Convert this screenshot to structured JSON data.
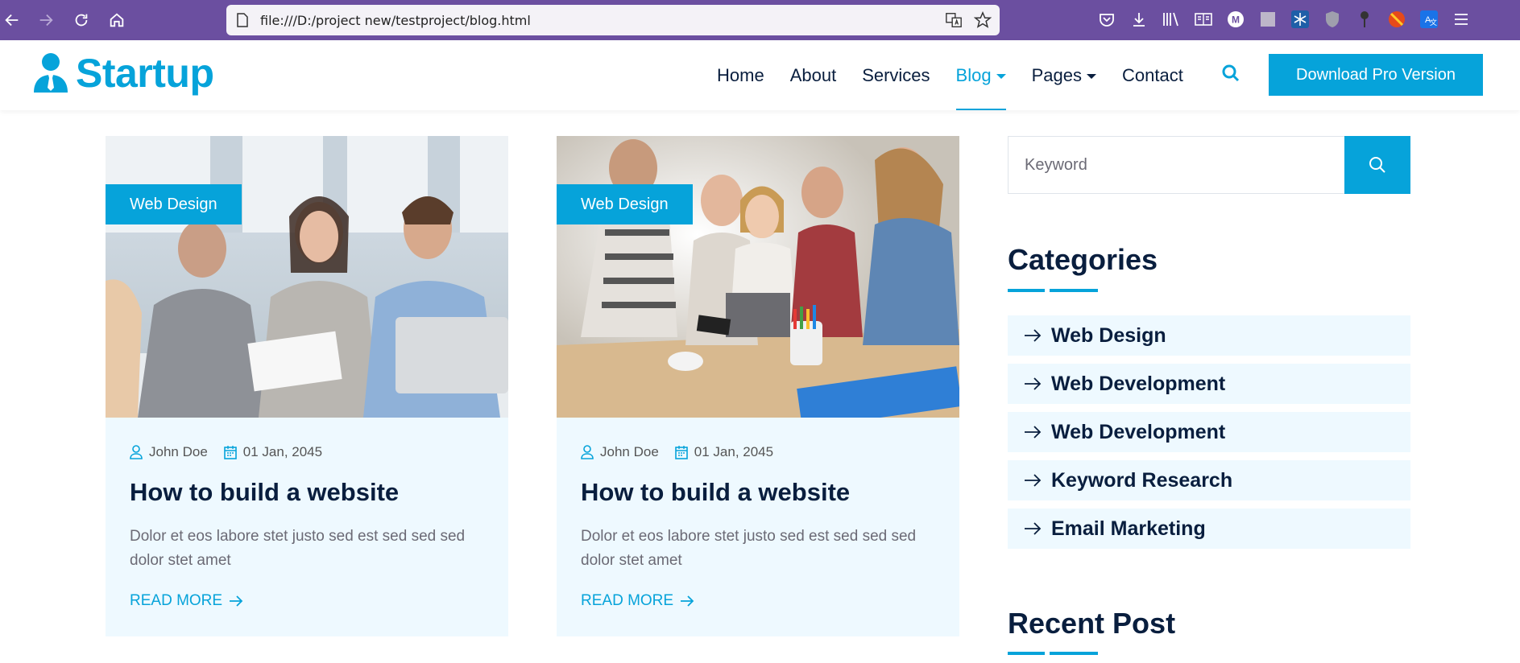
{
  "browser": {
    "url": "file:///D:/project new/testproject/blog.html"
  },
  "header": {
    "logo_text": "Startup",
    "menu": [
      {
        "label": "Home"
      },
      {
        "label": "About"
      },
      {
        "label": "Services"
      },
      {
        "label": "Blog",
        "dropdown": true,
        "active": true
      },
      {
        "label": "Pages",
        "dropdown": true
      },
      {
        "label": "Contact"
      }
    ],
    "cta_label": "Download Pro Version"
  },
  "posts": [
    {
      "tag": "Web Design",
      "author": "John Doe",
      "date": "01 Jan, 2045",
      "title": "How to build a website",
      "excerpt": "Dolor et eos labore stet justo sed est sed sed sed dolor stet amet",
      "read_more": "READ MORE"
    },
    {
      "tag": "Web Design",
      "author": "John Doe",
      "date": "01 Jan, 2045",
      "title": "How to build a website",
      "excerpt": "Dolor et eos labore stet justo sed est sed sed sed dolor stet amet",
      "read_more": "READ MORE"
    }
  ],
  "sidebar": {
    "search_placeholder": "Keyword",
    "categories_title": "Categories",
    "categories": [
      "Web Design",
      "Web Development",
      "Web Development",
      "Keyword Research",
      "Email Marketing"
    ],
    "recent_title": "Recent Post"
  },
  "colors": {
    "primary": "#06A3DA",
    "dark": "#091E3E",
    "light_bg": "#EEF9FF",
    "browser_bar": "#6b4fa0"
  }
}
